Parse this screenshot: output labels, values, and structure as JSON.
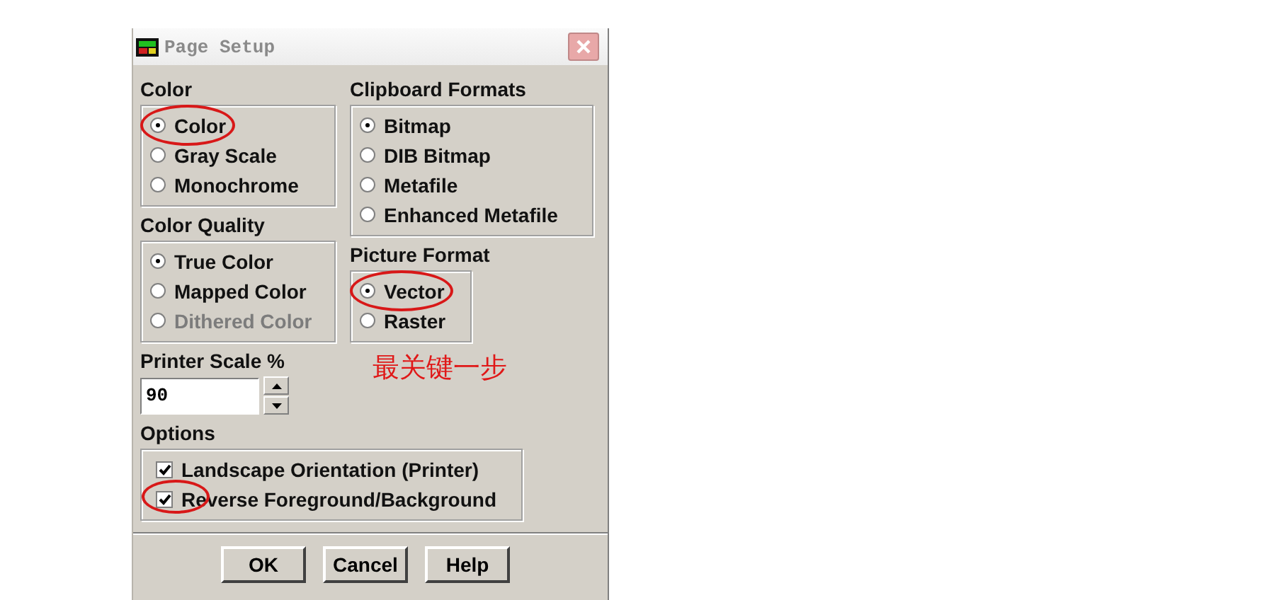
{
  "window": {
    "title": "Page Setup"
  },
  "color": {
    "label": "Color",
    "options": [
      {
        "label": "Color",
        "selected": true,
        "disabled": false,
        "circled": true
      },
      {
        "label": "Gray Scale",
        "selected": false,
        "disabled": false,
        "circled": false
      },
      {
        "label": "Monochrome",
        "selected": false,
        "disabled": false,
        "circled": false
      }
    ]
  },
  "color_quality": {
    "label": "Color Quality",
    "options": [
      {
        "label": "True Color",
        "selected": true,
        "disabled": false,
        "circled": false
      },
      {
        "label": "Mapped Color",
        "selected": false,
        "disabled": false,
        "circled": false
      },
      {
        "label": "Dithered Color",
        "selected": false,
        "disabled": true,
        "circled": false
      }
    ]
  },
  "printer_scale": {
    "label": "Printer Scale %",
    "value": "90"
  },
  "clipboard_formats": {
    "label": "Clipboard Formats",
    "options": [
      {
        "label": "Bitmap",
        "selected": true,
        "disabled": false,
        "circled": false
      },
      {
        "label": "DIB Bitmap",
        "selected": false,
        "disabled": false,
        "circled": false
      },
      {
        "label": "Metafile",
        "selected": false,
        "disabled": false,
        "circled": false
      },
      {
        "label": "Enhanced Metafile",
        "selected": false,
        "disabled": false,
        "circled": false
      }
    ]
  },
  "picture_format": {
    "label": "Picture Format",
    "options": [
      {
        "label": "Vector",
        "selected": true,
        "disabled": false,
        "circled": true
      },
      {
        "label": "Raster",
        "selected": false,
        "disabled": false,
        "circled": false
      }
    ]
  },
  "annotation": {
    "note": "最关键一步"
  },
  "options": {
    "label": "Options",
    "items": [
      {
        "label": "Landscape Orientation (Printer)",
        "checked": true,
        "circled": false
      },
      {
        "label": "Reverse Foreground/Background",
        "checked": true,
        "circled": true
      }
    ]
  },
  "buttons": [
    "OK",
    "Cancel",
    "Help"
  ]
}
